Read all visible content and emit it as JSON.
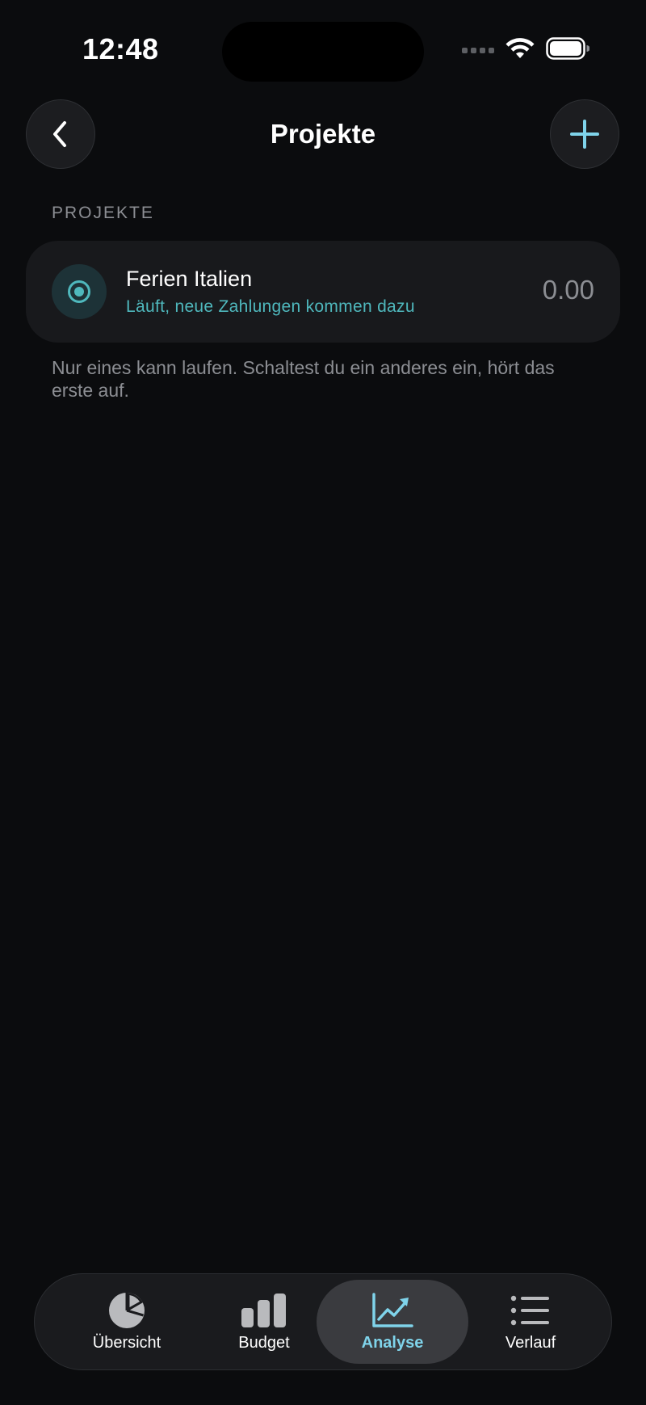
{
  "status_bar": {
    "time": "12:48"
  },
  "header": {
    "title": "Projekte",
    "back_icon": "chevron-left-icon",
    "add_icon": "plus-icon"
  },
  "section": {
    "title": "PROJEKTE",
    "projects": [
      {
        "name": "Ferien Italien",
        "status": "Läuft, neue Zahlungen kommen dazu",
        "amount": "0.00",
        "icon": "active-radio-icon"
      }
    ],
    "footnote": "Nur eines kann laufen. Schaltest du ein anderes ein, hört das erste auf."
  },
  "tab_bar": {
    "tabs": [
      {
        "label": "Übersicht",
        "icon": "pie-chart-icon",
        "active": false
      },
      {
        "label": "Budget",
        "icon": "bar-chart-icon",
        "active": false
      },
      {
        "label": "Analyse",
        "icon": "trend-chart-icon",
        "active": true
      },
      {
        "label": "Verlauf",
        "icon": "list-icon",
        "active": false
      }
    ]
  },
  "colors": {
    "background": "#0b0c0e",
    "card": "#18191c",
    "accent_teal": "#4fb8bd",
    "accent_blue": "#7fd3ea",
    "secondary_text": "#8c8e93"
  }
}
